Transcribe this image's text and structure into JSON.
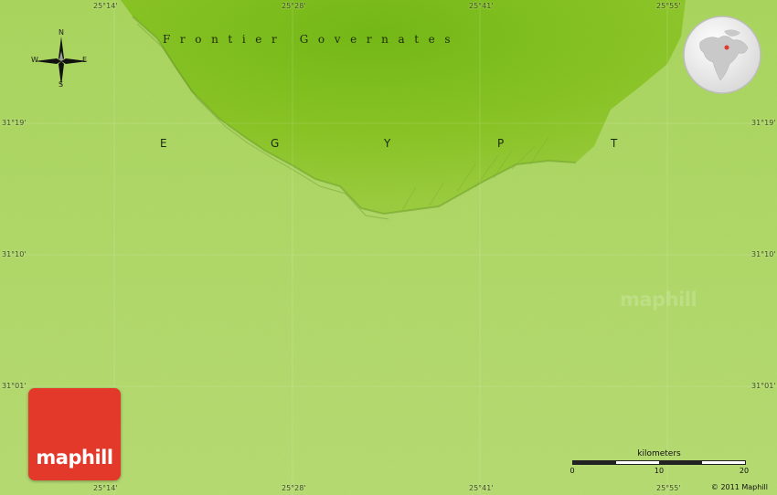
{
  "map": {
    "region_label": "Frontier Governates",
    "country_letters": [
      "E",
      "G",
      "Y",
      "P",
      "T"
    ]
  },
  "coordinates": {
    "longitudes": [
      "25°14'",
      "25°28'",
      "25°41'",
      "25°55'"
    ],
    "latitudes": [
      "31°19'",
      "31°10'",
      "31°01'"
    ]
  },
  "compass": {
    "n": "N",
    "s": "S",
    "e": "E",
    "w": "W"
  },
  "scale": {
    "title": "kilometers",
    "ticks": [
      "0",
      "10",
      "20"
    ]
  },
  "brand": {
    "logo_text": "maphill",
    "watermark": "maphill"
  },
  "copyright": "© 2011 Maphill",
  "colors": {
    "lowland": "#b5dc6f",
    "highland": "#86c41e",
    "logo": "#e3392b"
  },
  "icons": {
    "compass": "compass-rose-icon",
    "locator": "globe-locator-icon"
  }
}
